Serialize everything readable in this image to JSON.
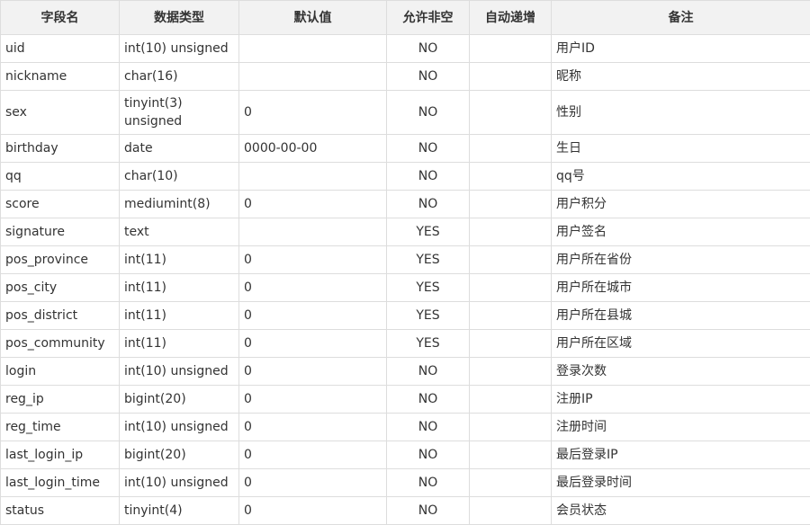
{
  "table": {
    "headers": [
      "字段名",
      "数据类型",
      "默认值",
      "允许非空",
      "自动递增",
      "备注"
    ],
    "rows": [
      {
        "name": "uid",
        "type": "int(10) unsigned",
        "default": "",
        "nullable": "NO",
        "auto_increment": "",
        "comment": "用户ID"
      },
      {
        "name": "nickname",
        "type": "char(16)",
        "default": "",
        "nullable": "NO",
        "auto_increment": "",
        "comment": "昵称"
      },
      {
        "name": "sex",
        "type": "tinyint(3) unsigned",
        "default": "0",
        "nullable": "NO",
        "auto_increment": "",
        "comment": "性别"
      },
      {
        "name": "birthday",
        "type": "date",
        "default": "0000-00-00",
        "nullable": "NO",
        "auto_increment": "",
        "comment": "生日"
      },
      {
        "name": "qq",
        "type": "char(10)",
        "default": "",
        "nullable": "NO",
        "auto_increment": "",
        "comment": "qq号"
      },
      {
        "name": "score",
        "type": "mediumint(8)",
        "default": "0",
        "nullable": "NO",
        "auto_increment": "",
        "comment": "用户积分"
      },
      {
        "name": "signature",
        "type": "text",
        "default": "",
        "nullable": "YES",
        "auto_increment": "",
        "comment": "用户签名"
      },
      {
        "name": "pos_province",
        "type": "int(11)",
        "default": "0",
        "nullable": "YES",
        "auto_increment": "",
        "comment": "用户所在省份"
      },
      {
        "name": "pos_city",
        "type": "int(11)",
        "default": "0",
        "nullable": "YES",
        "auto_increment": "",
        "comment": "用户所在城市"
      },
      {
        "name": "pos_district",
        "type": "int(11)",
        "default": "0",
        "nullable": "YES",
        "auto_increment": "",
        "comment": "用户所在县城"
      },
      {
        "name": "pos_community",
        "type": "int(11)",
        "default": "0",
        "nullable": "YES",
        "auto_increment": "",
        "comment": "用户所在区域"
      },
      {
        "name": "login",
        "type": "int(10) unsigned",
        "default": "0",
        "nullable": "NO",
        "auto_increment": "",
        "comment": "登录次数"
      },
      {
        "name": "reg_ip",
        "type": "bigint(20)",
        "default": "0",
        "nullable": "NO",
        "auto_increment": "",
        "comment": "注册IP"
      },
      {
        "name": "reg_time",
        "type": "int(10) unsigned",
        "default": "0",
        "nullable": "NO",
        "auto_increment": "",
        "comment": "注册时间"
      },
      {
        "name": "last_login_ip",
        "type": "bigint(20)",
        "default": "0",
        "nullable": "NO",
        "auto_increment": "",
        "comment": "最后登录IP"
      },
      {
        "name": "last_login_time",
        "type": "int(10) unsigned",
        "default": "0",
        "nullable": "NO",
        "auto_increment": "",
        "comment": "最后登录时间"
      },
      {
        "name": "status",
        "type": "tinyint(4)",
        "default": "0",
        "nullable": "NO",
        "auto_increment": "",
        "comment": "会员状态"
      }
    ]
  }
}
